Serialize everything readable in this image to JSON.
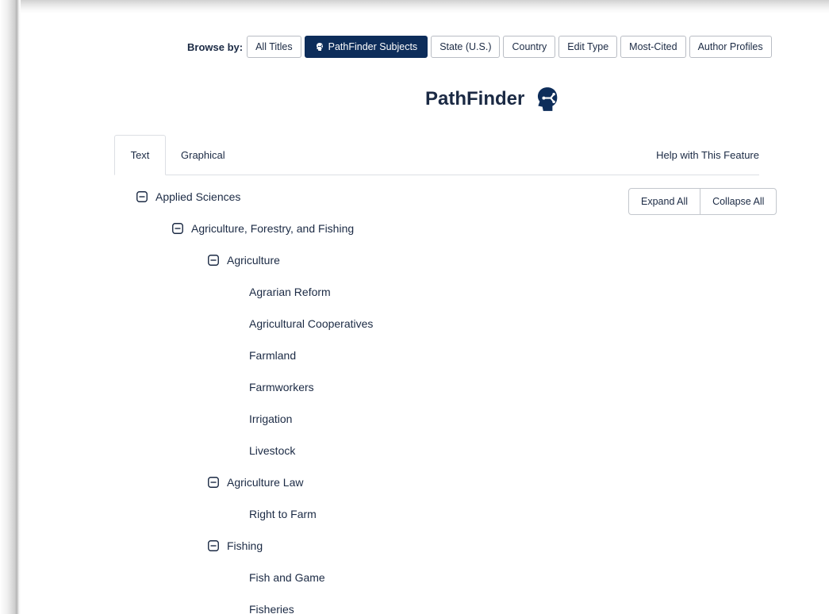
{
  "browse": {
    "label": "Browse by:",
    "buttons": [
      {
        "label": "All Titles",
        "active": false
      },
      {
        "label": "PathFinder Subjects",
        "active": true
      },
      {
        "label": "State (U.S.)",
        "active": false
      },
      {
        "label": "Country",
        "active": false
      },
      {
        "label": "Edit Type",
        "active": false
      },
      {
        "label": "Most-Cited",
        "active": false
      },
      {
        "label": "Author Profiles",
        "active": false
      }
    ]
  },
  "page": {
    "title": "PathFinder",
    "title_icon": "head-network-icon"
  },
  "tabs": [
    {
      "label": "Text",
      "active": true
    },
    {
      "label": "Graphical",
      "active": false
    }
  ],
  "help_label": "Help with This Feature",
  "controls": {
    "expand_all": "Expand All",
    "collapse_all": "Collapse All"
  },
  "tree": [
    {
      "label": "Applied Sciences",
      "level": 0,
      "expandable": true,
      "expanded": true
    },
    {
      "label": "Agriculture, Forestry, and Fishing",
      "level": 1,
      "expandable": true,
      "expanded": true
    },
    {
      "label": "Agriculture",
      "level": 2,
      "expandable": true,
      "expanded": true
    },
    {
      "label": "Agrarian Reform",
      "level": 3,
      "expandable": false
    },
    {
      "label": "Agricultural Cooperatives",
      "level": 3,
      "expandable": false
    },
    {
      "label": "Farmland",
      "level": 3,
      "expandable": false
    },
    {
      "label": "Farmworkers",
      "level": 3,
      "expandable": false
    },
    {
      "label": "Irrigation",
      "level": 3,
      "expandable": false
    },
    {
      "label": "Livestock",
      "level": 3,
      "expandable": false
    },
    {
      "label": "Agriculture Law",
      "level": 2,
      "expandable": true,
      "expanded": true
    },
    {
      "label": "Right to Farm",
      "level": 3,
      "expandable": false
    },
    {
      "label": "Fishing",
      "level": 2,
      "expandable": true,
      "expanded": true
    },
    {
      "label": "Fish and Game",
      "level": 3,
      "expandable": false
    },
    {
      "label": "Fisheries",
      "level": 3,
      "expandable": false
    }
  ],
  "colors": {
    "navy": "#0d2d5a",
    "text": "#1b2a44",
    "border": "#b9bdc4"
  }
}
